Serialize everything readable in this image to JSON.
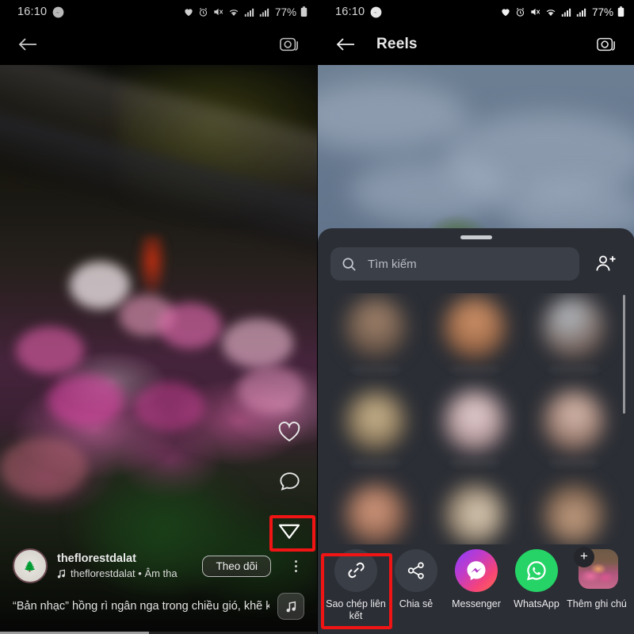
{
  "status_bar": {
    "time": "16:10",
    "battery_percent": "77%",
    "icons": [
      "messenger-badge-icon",
      "heart-icon",
      "alarm-icon",
      "mute-icon",
      "wifi-icon",
      "signal-icon",
      "signal-icon",
      "battery-icon"
    ]
  },
  "left_screen": {
    "header": {
      "title": "",
      "back_icon": "back-arrow-icon",
      "camera_icon": "camera-icon"
    },
    "actions": {
      "like": "heart-icon",
      "comment": "comment-icon",
      "share": "share-paper-plane-icon"
    },
    "post": {
      "username": "theflorestdalat",
      "audio": "theflorestdalat • Âm tha",
      "follow_label": "Theo dõi",
      "caption": "“Bản nhạc” hồng rì ngân nga trong chiều gió, khẽ khà ...",
      "music_icon": "music-note-icon",
      "more_icon": "more-options-icon",
      "progress_percent": 47
    },
    "highlight_color": "#f01414"
  },
  "right_screen": {
    "header": {
      "title": "Reels",
      "back_icon": "back-arrow-icon",
      "camera_icon": "camera-icon"
    },
    "share_sheet": {
      "grabber": "drag-handle",
      "search_placeholder": "Tìm kiếm",
      "search_value": "",
      "search_icon": "search-icon",
      "add_people_icon": "add-person-icon",
      "contacts_blurred_count": 9,
      "apps": [
        {
          "label": "Sao chép liên kết",
          "icon": "link-icon",
          "style": "grey",
          "highlighted": true
        },
        {
          "label": "Chia sẻ",
          "icon": "share-nodes-icon",
          "style": "grey",
          "highlighted": false
        },
        {
          "label": "Messenger",
          "icon": "messenger-icon",
          "style": "messenger",
          "highlighted": false
        },
        {
          "label": "WhatsApp",
          "icon": "whatsapp-icon",
          "style": "whatsapp",
          "highlighted": false
        },
        {
          "label": "Thêm ghi chú",
          "icon": "add-note-icon",
          "style": "thumb",
          "highlighted": false
        }
      ]
    },
    "highlight_color": "#f01414"
  }
}
